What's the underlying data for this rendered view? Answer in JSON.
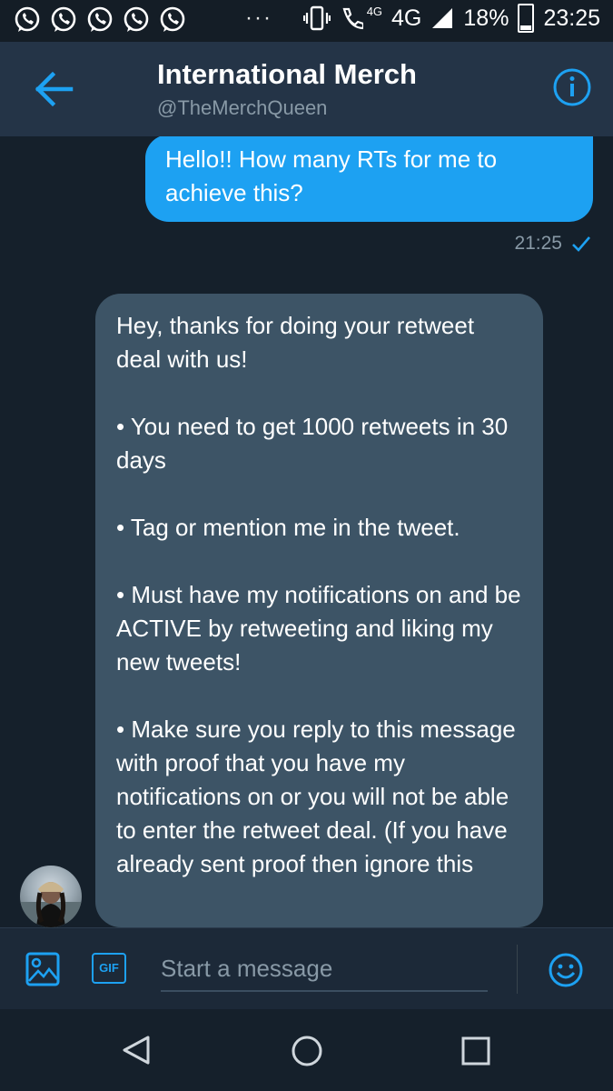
{
  "status_bar": {
    "notification_icons": [
      "whatsapp-icon",
      "whatsapp-icon",
      "whatsapp-icon",
      "whatsapp-icon",
      "whatsapp-icon"
    ],
    "more_indicator": "···",
    "call_network": "4G",
    "network": "4G",
    "battery": "18%",
    "time": "23:25"
  },
  "header": {
    "title": "International Merch",
    "handle": "@TheMerchQueen"
  },
  "messages": {
    "outgoing": {
      "text": "Hello!! How many RTs for me to achieve this?",
      "time": "21:25"
    },
    "incoming": {
      "text": "Hey, thanks for doing your retweet deal with us!\n\n• You need to get 1000 retweets in 30 days\n\n• Tag or mention me in the tweet.\n\n• Must have my notifications on and be ACTIVE by retweeting and liking my new tweets!\n\n• Make sure you reply to this message with proof that you have my notifications on or you will not be able to enter the retweet deal. (If you have already sent proof then ignore this"
    }
  },
  "composer": {
    "gif_label": "GIF",
    "placeholder": "Start a message"
  },
  "colors": {
    "accent": "#1da1f2",
    "background": "#15202b",
    "header": "#243447",
    "incoming_bubble": "#3d5466"
  }
}
